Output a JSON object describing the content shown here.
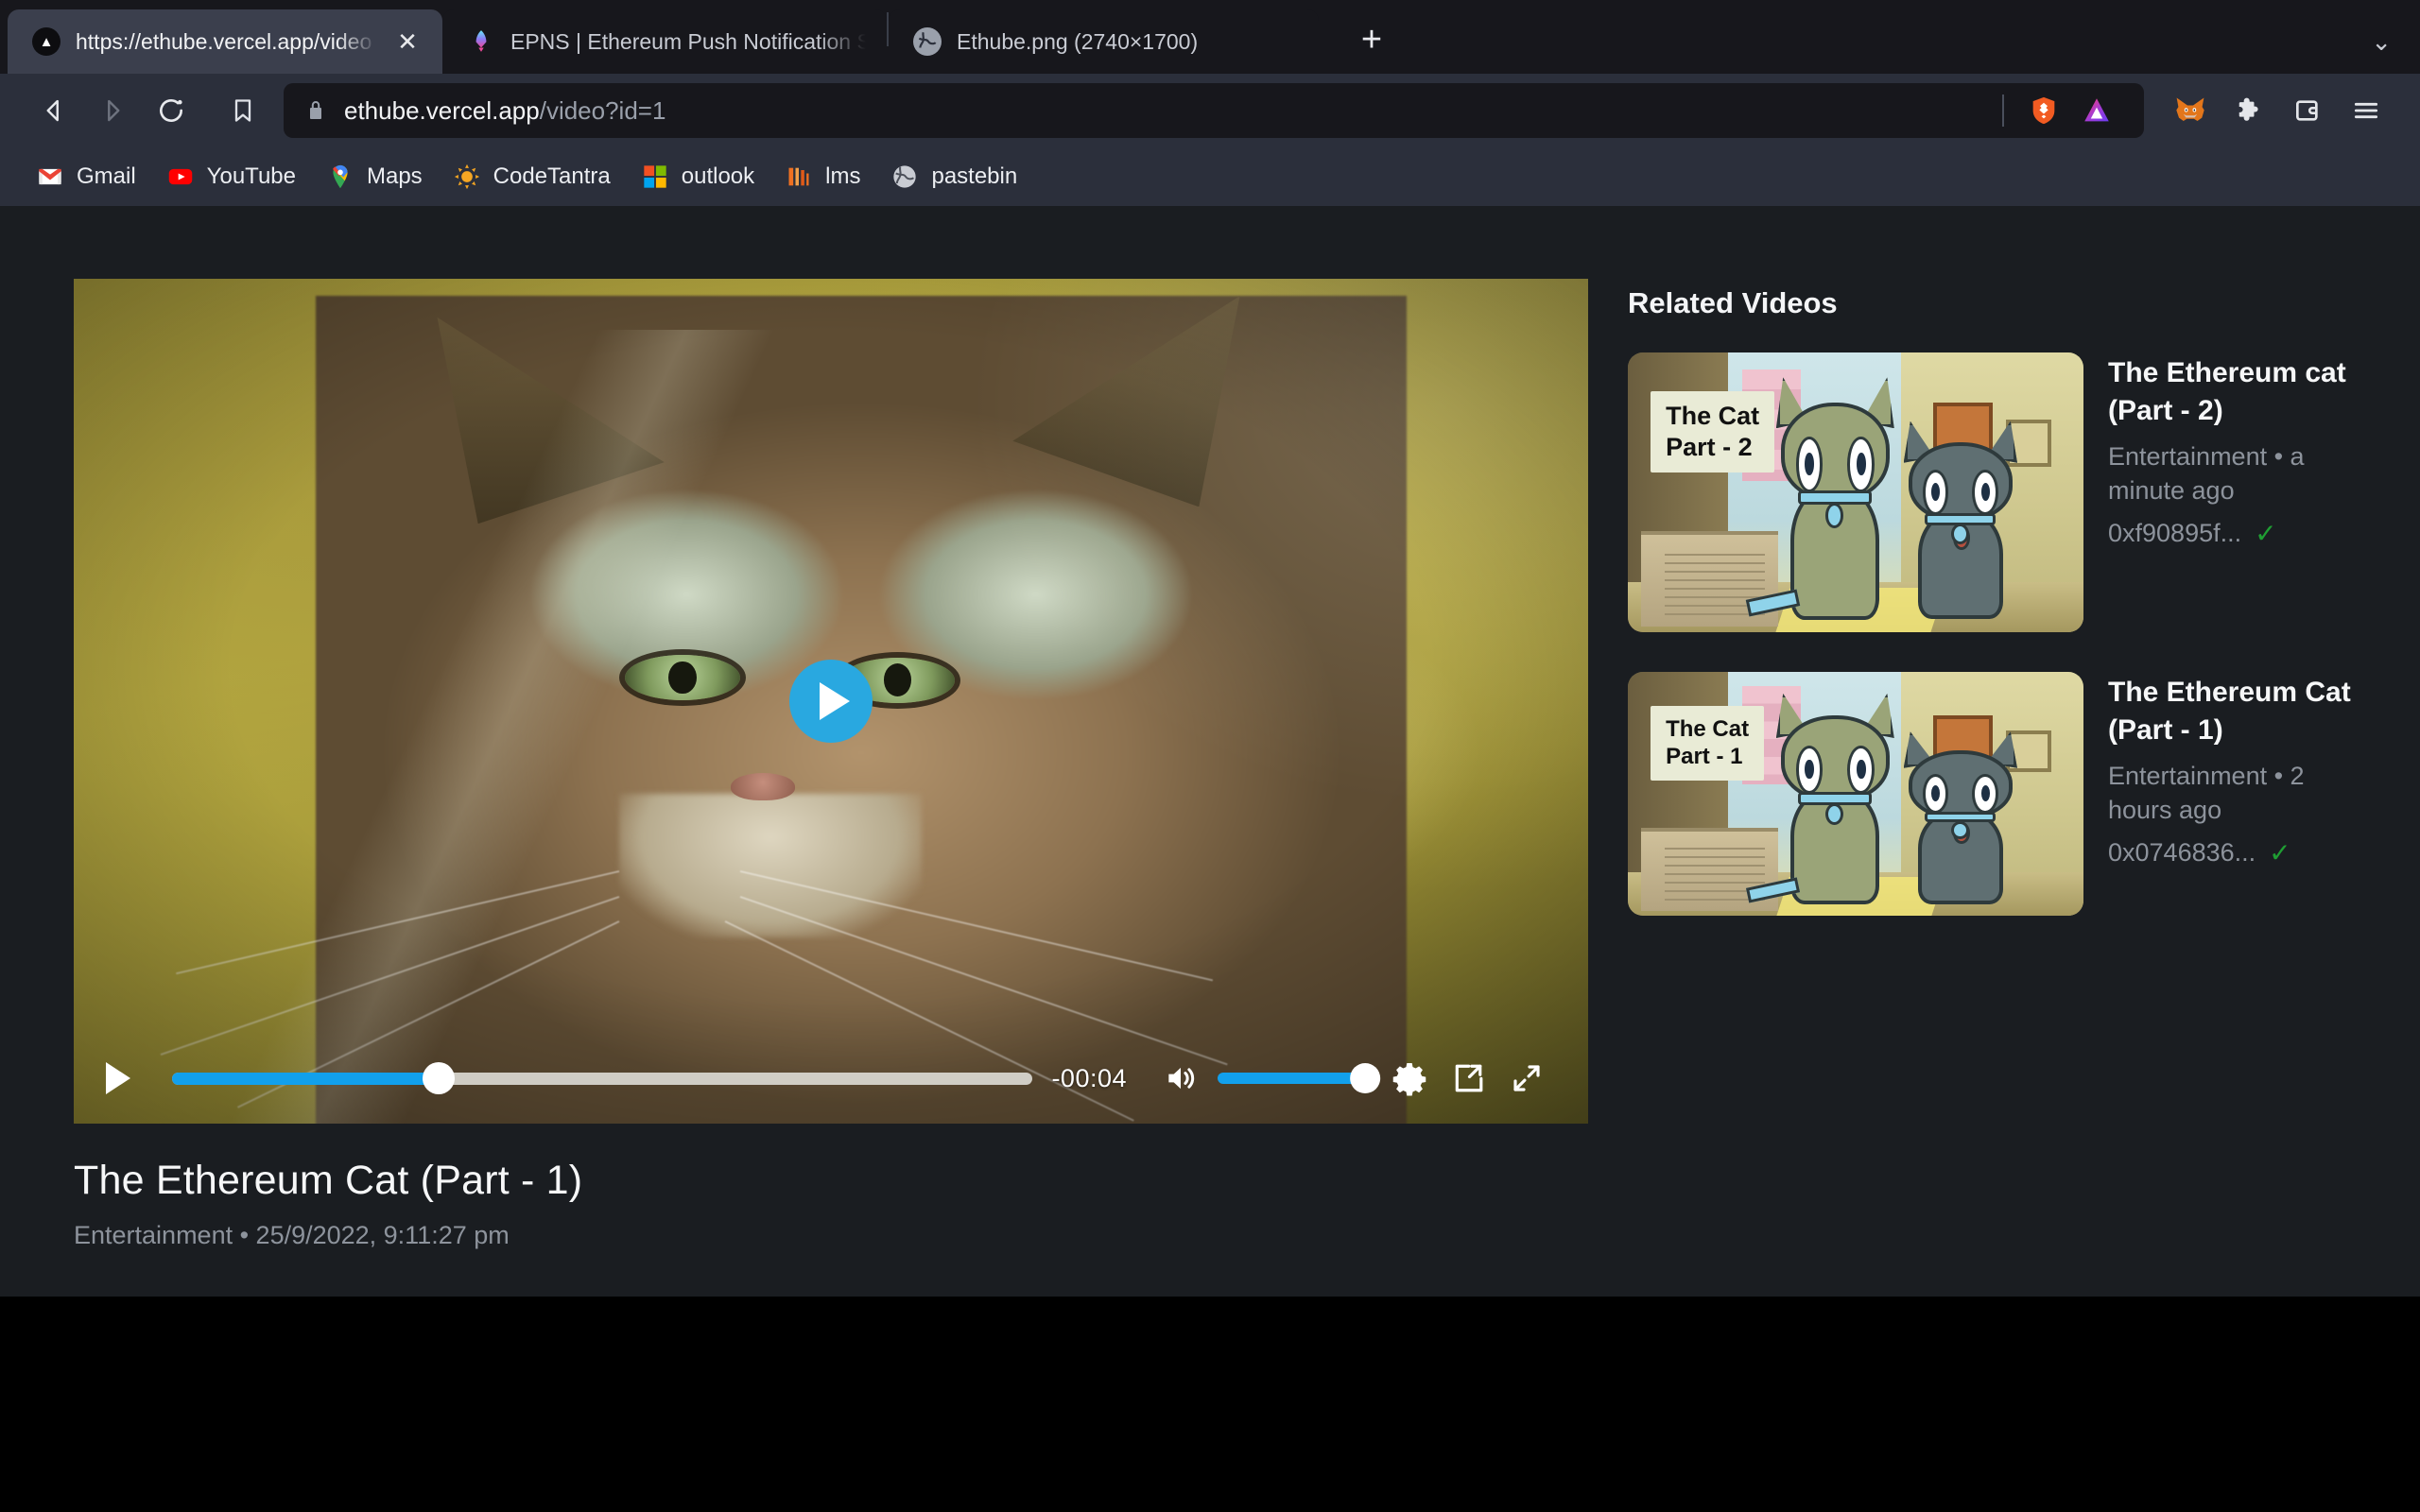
{
  "browser": {
    "tabs": [
      {
        "title": "https://ethube.vercel.app/video",
        "favicon": "ethube-triangle-icon",
        "active": true,
        "close_label": "✕"
      },
      {
        "title": "EPNS | Ethereum Push Notification S",
        "favicon": "epns-rocket-icon",
        "active": false
      },
      {
        "title": "Ethube.png (2740×1700)",
        "favicon": "image-globe-icon",
        "active": false
      }
    ],
    "new_tab_label": "+",
    "tablist_chevron": "⌄",
    "toolbar": {
      "back_icon": "back-arrow-icon",
      "forward_icon": "forward-arrow-icon",
      "reload_icon": "reload-icon",
      "bookmark_icon": "bookmark-icon",
      "lock_icon": "lock-icon",
      "url_host": "ethube.vercel.app",
      "url_path": "/video?id=1",
      "url_full": "ethube.vercel.app/video?id=1",
      "shields_icon": "brave-shields-lion-icon",
      "rewards_icon": "brave-rewards-bat-icon",
      "metamask_icon": "metamask-fox-icon",
      "extensions_icon": "extensions-puzzle-icon",
      "wallet_icon": "brave-wallet-icon",
      "menu_icon": "hamburger-menu-icon"
    },
    "bookmarks": [
      {
        "label": "Gmail",
        "icon": "gmail-icon"
      },
      {
        "label": "YouTube",
        "icon": "youtube-icon"
      },
      {
        "label": "Maps",
        "icon": "google-maps-icon"
      },
      {
        "label": "CodeTantra",
        "icon": "codetantra-icon"
      },
      {
        "label": "outlook",
        "icon": "outlook-icon"
      },
      {
        "label": "lms",
        "icon": "lms-icon"
      },
      {
        "label": "pastebin",
        "icon": "pastebin-globe-icon"
      }
    ]
  },
  "player": {
    "play_overlay_icon": "play-circle-icon",
    "play_button_icon": "play-icon",
    "progress_percent": 31,
    "time_remaining": "-00:04",
    "volume_icon": "volume-high-icon",
    "volume_percent": 100,
    "settings_icon": "gear-icon",
    "pip_icon": "picture-in-picture-icon",
    "fullscreen_icon": "fullscreen-expand-icon",
    "accent_color": "#12a0ec"
  },
  "video": {
    "title": "The Ethereum Cat (Part - 1)",
    "subtitle": "Entertainment • 25/9/2022, 9:11:27 pm",
    "category": "Entertainment",
    "published": "25/9/2022, 9:11:27 pm"
  },
  "sidebar": {
    "heading": "Related Videos",
    "videos": [
      {
        "title": "The Ethereum cat (Part - 2)",
        "category_time": "Entertainment • a minute ago",
        "address": "0xf90895f...",
        "verified_icon": "verified-check-icon",
        "verified_color": "#1f9e33",
        "thumb_badge_line1": "The Cat",
        "thumb_badge_line2": "Part - 2"
      },
      {
        "title": "The Ethereum Cat (Part - 1)",
        "category_time": "Entertainment • 2 hours ago",
        "address": "0x0746836...",
        "verified_icon": "verified-check-icon",
        "verified_color": "#1f9e33",
        "thumb_badge_line1": "The Cat",
        "thumb_badge_line2": "Part - 1"
      }
    ]
  }
}
